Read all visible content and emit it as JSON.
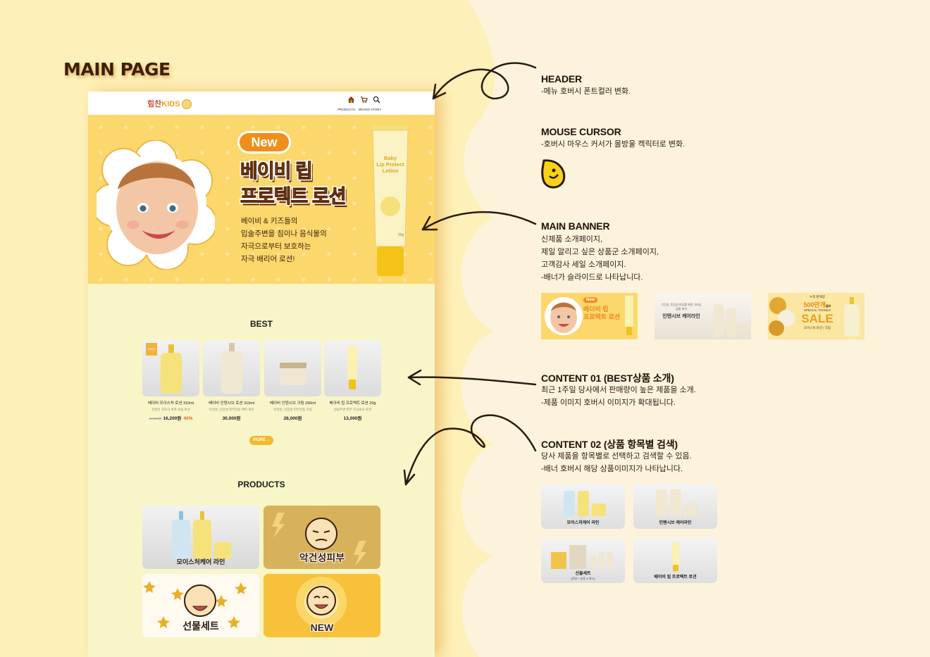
{
  "page_title": "MAIN PAGE",
  "mockup": {
    "header": {
      "logo_main": "힘찬",
      "logo_kids": "KIDS",
      "nav": [
        "PRODUCTS",
        "BRAND STORY"
      ]
    },
    "banner": {
      "badge": "New",
      "title_line1": "베이비 립",
      "title_line2": "프로텍트 로션",
      "desc": [
        "베이비 & 키즈들의",
        "입술주변을 침이나 음식물의",
        "자극으로부터 보호하는",
        "자극 배리어 로션!"
      ],
      "tube_text": [
        "Baby",
        "Lip Protect",
        "Lotion"
      ],
      "tube_size": "20g"
    },
    "best": {
      "title": "BEST",
      "items": [
        {
          "name": "베이비 모이스처 로션 310ml",
          "sub": "유칼리 저자극 촉촉 보습 로션",
          "old": "27,000원",
          "price": "16,200원",
          "off": "40%",
          "sale_badge": "SALE"
        },
        {
          "name": "베이비 인텐시브 로션 310ml",
          "sub": "악건성, 민감성 피부전용 케어 로션",
          "old": "",
          "price": "30,000원",
          "off": ""
        },
        {
          "name": "베이비 인텐시브 크림 200ml",
          "sub": "악건성, 민감성 피부전용 크림",
          "old": "",
          "price": "28,000원",
          "off": ""
        },
        {
          "name": "베이비 립 프로텍트 로션 20g",
          "sub": "입술주변 피부 자극보호 로션",
          "old": "",
          "price": "13,000원",
          "off": ""
        }
      ],
      "more": "MORE→"
    },
    "products": {
      "title": "PRODUCTS",
      "tiles": [
        "모이스처케어 라인",
        "악건성피부",
        "선물세트",
        "NEW"
      ]
    }
  },
  "annotations": [
    {
      "heading": "HEADER",
      "lines": [
        "-메뉴 호버시 폰트컬러 변화."
      ]
    },
    {
      "heading": "MOUSE CURSOR",
      "lines": [
        "-호버시 마우스 커서가 몰방울 캑릭터로 변화."
      ]
    },
    {
      "heading": "MAIN BANNER",
      "lines": [
        "신제품 소개페이지,",
        "제일 알리고 싶은 상품군 소개페이지,",
        "고객감사 세일 소개페이지.",
        "-배너가 슬라이드로 나타납니다."
      ]
    },
    {
      "heading": "CONTENT 01 (BEST상품 소개)",
      "lines": [
        "최근 1주일 당사에서 판매량이 높은 제품을 소개.",
        "-제품 이미지 호버시 이미지가 확대됩니다."
      ]
    },
    {
      "heading": "CONTENT 02 (상품 항목별 검색)",
      "lines": [
        "당사 제품을 항목별로 선택하고 검색할 수 있음.",
        "-배너 호버시 해당 상품이미지가 나타납니다."
      ]
    }
  ],
  "banner_thumbs": [
    {
      "badge": "New",
      "title1": "베이비 립",
      "title2": "프로텍트 로션"
    },
    {
      "sub": "악건성, 민감성 피부를 위한 고보습 집중 케어",
      "title": "인텐시브 케어라인"
    },
    {
      "top": "누적 판매량",
      "count": "500만개",
      "suffix": "돌파",
      "thanks": "SPECIAL THANKS",
      "sale": "SALE",
      "note": "모이스처 로션 / 크림"
    }
  ],
  "content02_tiles": [
    {
      "label": "모이스처케어 라인"
    },
    {
      "label": "인텐시브 케어라인"
    },
    {
      "label": "선물세트",
      "sub": "(로션 + 샴푸 & 워시)"
    },
    {
      "label": "베이비 립 프로텍트 로션"
    }
  ],
  "colors": {
    "background": "#fdf0b8",
    "cream_panel": "#fdf3dc",
    "accent_orange": "#f08e1c",
    "banner_yellow": "#fcd76b",
    "brown": "#3d1f0a"
  }
}
